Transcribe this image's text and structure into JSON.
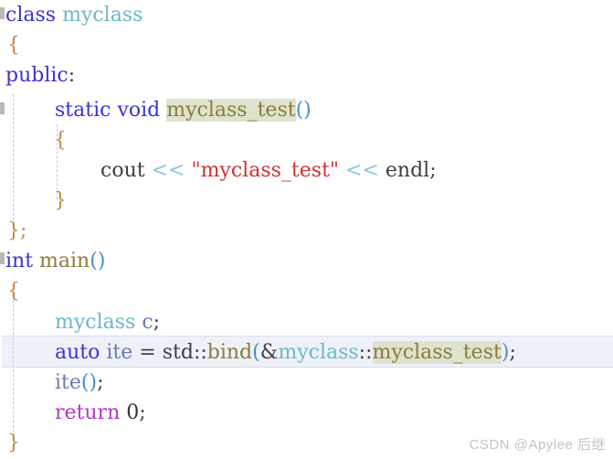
{
  "editor": {
    "background": "#ffffff",
    "language": "C++",
    "occurrence_highlight_color": "#dde3cd",
    "current_line_highlight_color": "#eef1f8",
    "indent_guide_color": "#c9c9c9",
    "highlighted_symbol": "myclass_test",
    "current_line_number": 12
  },
  "colors": {
    "keyword": "#3a34d2",
    "classname": "#6fb6c9",
    "function": "#8c7b3f",
    "string": "#cc3333",
    "operator": "#8fc6e0",
    "return_keyword": "#b337c4",
    "variable": "#6a7ab5",
    "plain": "#333333"
  },
  "code": {
    "lines": [
      {
        "n": 1,
        "indent": 0,
        "text": "class myclass"
      },
      {
        "n": 2,
        "indent": 0,
        "text": "{"
      },
      {
        "n": 3,
        "indent": 0,
        "text": "public:"
      },
      {
        "n": 4,
        "indent": 1,
        "text": "static void myclass_test()"
      },
      {
        "n": 5,
        "indent": 1,
        "text": "{"
      },
      {
        "n": 6,
        "indent": 2,
        "text": "cout << \"myclass_test\" << endl;"
      },
      {
        "n": 7,
        "indent": 1,
        "text": "}"
      },
      {
        "n": 8,
        "indent": 0,
        "text": "};"
      },
      {
        "n": 9,
        "indent": 0,
        "text": "int main()"
      },
      {
        "n": 10,
        "indent": 0,
        "text": "{"
      },
      {
        "n": 11,
        "indent": 1,
        "text": "myclass c;"
      },
      {
        "n": 12,
        "indent": 1,
        "text": "auto ite = std::bind(&myclass::myclass_test);"
      },
      {
        "n": 13,
        "indent": 1,
        "text": "ite();"
      },
      {
        "n": 14,
        "indent": 1,
        "text": "return 0;"
      },
      {
        "n": 15,
        "indent": 0,
        "text": "}"
      }
    ],
    "l1_class_kw": "class",
    "l1_name": "myclass",
    "l2_brace": "{",
    "l3_public": "public",
    "l3_colon": ":",
    "l4_static": "static",
    "l4_void": "void",
    "l4_name": "myclass_test",
    "l4_parens": "()",
    "l5_brace": "{",
    "l6_cout": "cout",
    "l6_op1": "<<",
    "l6_string": "\"myclass_test\"",
    "l6_op2": "<<",
    "l6_endl": "endl",
    "l6_semi": ";",
    "l7_brace": "}",
    "l8_brace": "};",
    "l9_int": "int",
    "l9_main": "main",
    "l9_parens": "()",
    "l10_brace": "{",
    "l11_type": "myclass",
    "l11_var": "c",
    "l11_semi": ";",
    "l12_auto": "auto",
    "l12_var": "ite",
    "l12_eq": "=",
    "l12_std": "std",
    "l12_scope1": "::",
    "l12_bind": "bind",
    "l12_open": "(",
    "l12_amp": "&",
    "l12_class": "myclass",
    "l12_scope2": "::",
    "l12_member": "myclass_test",
    "l12_close": ")",
    "l12_semi": ";",
    "l13_var": "ite",
    "l13_parens": "()",
    "l13_semi": ";",
    "l14_return": "return",
    "l14_num": "0",
    "l14_semi": ";",
    "l15_brace": "}"
  },
  "watermark": {
    "text": "CSDN @Apylee 后继"
  }
}
